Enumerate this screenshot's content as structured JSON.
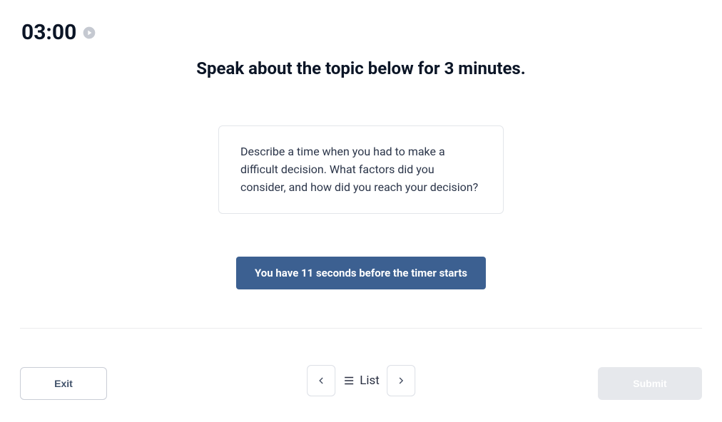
{
  "timer": {
    "display": "03:00"
  },
  "instruction": "Speak about the topic below for 3 minutes.",
  "prompt": "Describe a time when you had to make a difficult decision. What factors did you consider, and how did you reach your decision?",
  "countdown": "You have 11 seconds before the timer starts",
  "footer": {
    "exit": "Exit",
    "list": "List",
    "submit": "Submit"
  }
}
